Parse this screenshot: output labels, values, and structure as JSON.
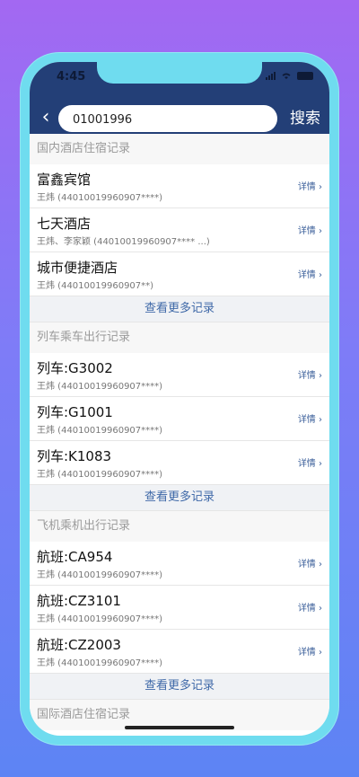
{
  "status": {
    "time": "4:45"
  },
  "nav": {
    "search_value": "01001996",
    "search_button": "搜索"
  },
  "sections": [
    {
      "title": "国内酒店住宿记录",
      "items": [
        {
          "title": "富鑫宾馆",
          "sub": "王炜 (44010019960907****)",
          "detail": "详情"
        },
        {
          "title": "七天酒店",
          "sub": "王炜、李家颖 (44010019960907****  ...)",
          "detail": "详情"
        },
        {
          "title": "城市便捷酒店",
          "sub": "王炜 (44010019960907**)",
          "detail": "详情"
        }
      ],
      "more": "查看更多记录"
    },
    {
      "title": "列车乘车出行记录",
      "items": [
        {
          "title": "列车:G3002",
          "sub": "王炜 (44010019960907****)",
          "detail": "详情"
        },
        {
          "title": "列车:G1001",
          "sub": "王炜 (44010019960907****)",
          "detail": "详情"
        },
        {
          "title": "列车:K1083",
          "sub": "王炜 (44010019960907****)",
          "detail": "详情"
        }
      ],
      "more": "查看更多记录"
    },
    {
      "title": "飞机乘机出行记录",
      "items": [
        {
          "title": "航班:CA954",
          "sub": "王炜 (44010019960907****)",
          "detail": "详情"
        },
        {
          "title": "航班:CZ3101",
          "sub": "王炜 (44010019960907****)",
          "detail": "详情"
        },
        {
          "title": "航班:CZ2003",
          "sub": "王炜 (44010019960907****)",
          "detail": "详情"
        }
      ],
      "more": "查看更多记录"
    },
    {
      "title": "国际酒店住宿记录"
    }
  ]
}
